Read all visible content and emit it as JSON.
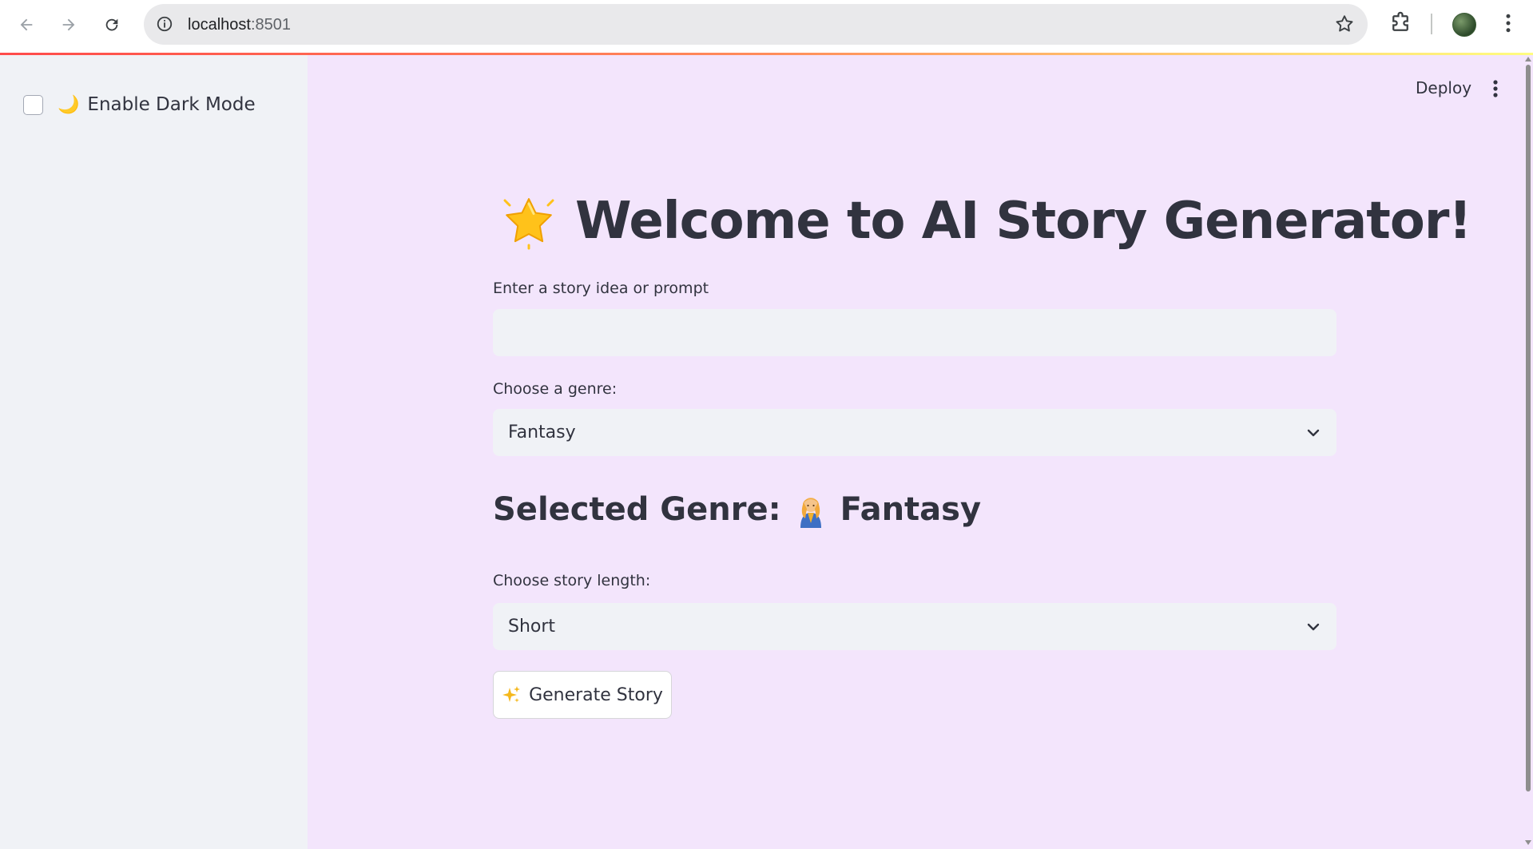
{
  "browser": {
    "url_host": "localhost",
    "url_port": ":8501",
    "back_icon": "arrow-left-icon",
    "forward_icon": "arrow-right-icon",
    "reload_icon": "reload-icon"
  },
  "sidebar": {
    "dark_mode_emoji": "🌙",
    "dark_mode_label": "Enable Dark Mode",
    "dark_mode_checked": false
  },
  "header": {
    "deploy_label": "Deploy"
  },
  "main": {
    "title": "Welcome to AI Story Generator!",
    "prompt_label": "Enter a story idea or prompt",
    "prompt_value": "",
    "genre_label": "Choose a genre:",
    "genre_value": "Fantasy",
    "selected_genre_prefix": "Selected Genre:",
    "selected_genre_value": "Fantasy",
    "length_label": "Choose story length:",
    "length_value": "Short",
    "generate_label": "Generate Story"
  },
  "colors": {
    "main_bg": "#f3e5fc",
    "sidebar_bg": "#f0f2f6",
    "text": "#31333f",
    "accent_bar": "#ff4b4b"
  }
}
